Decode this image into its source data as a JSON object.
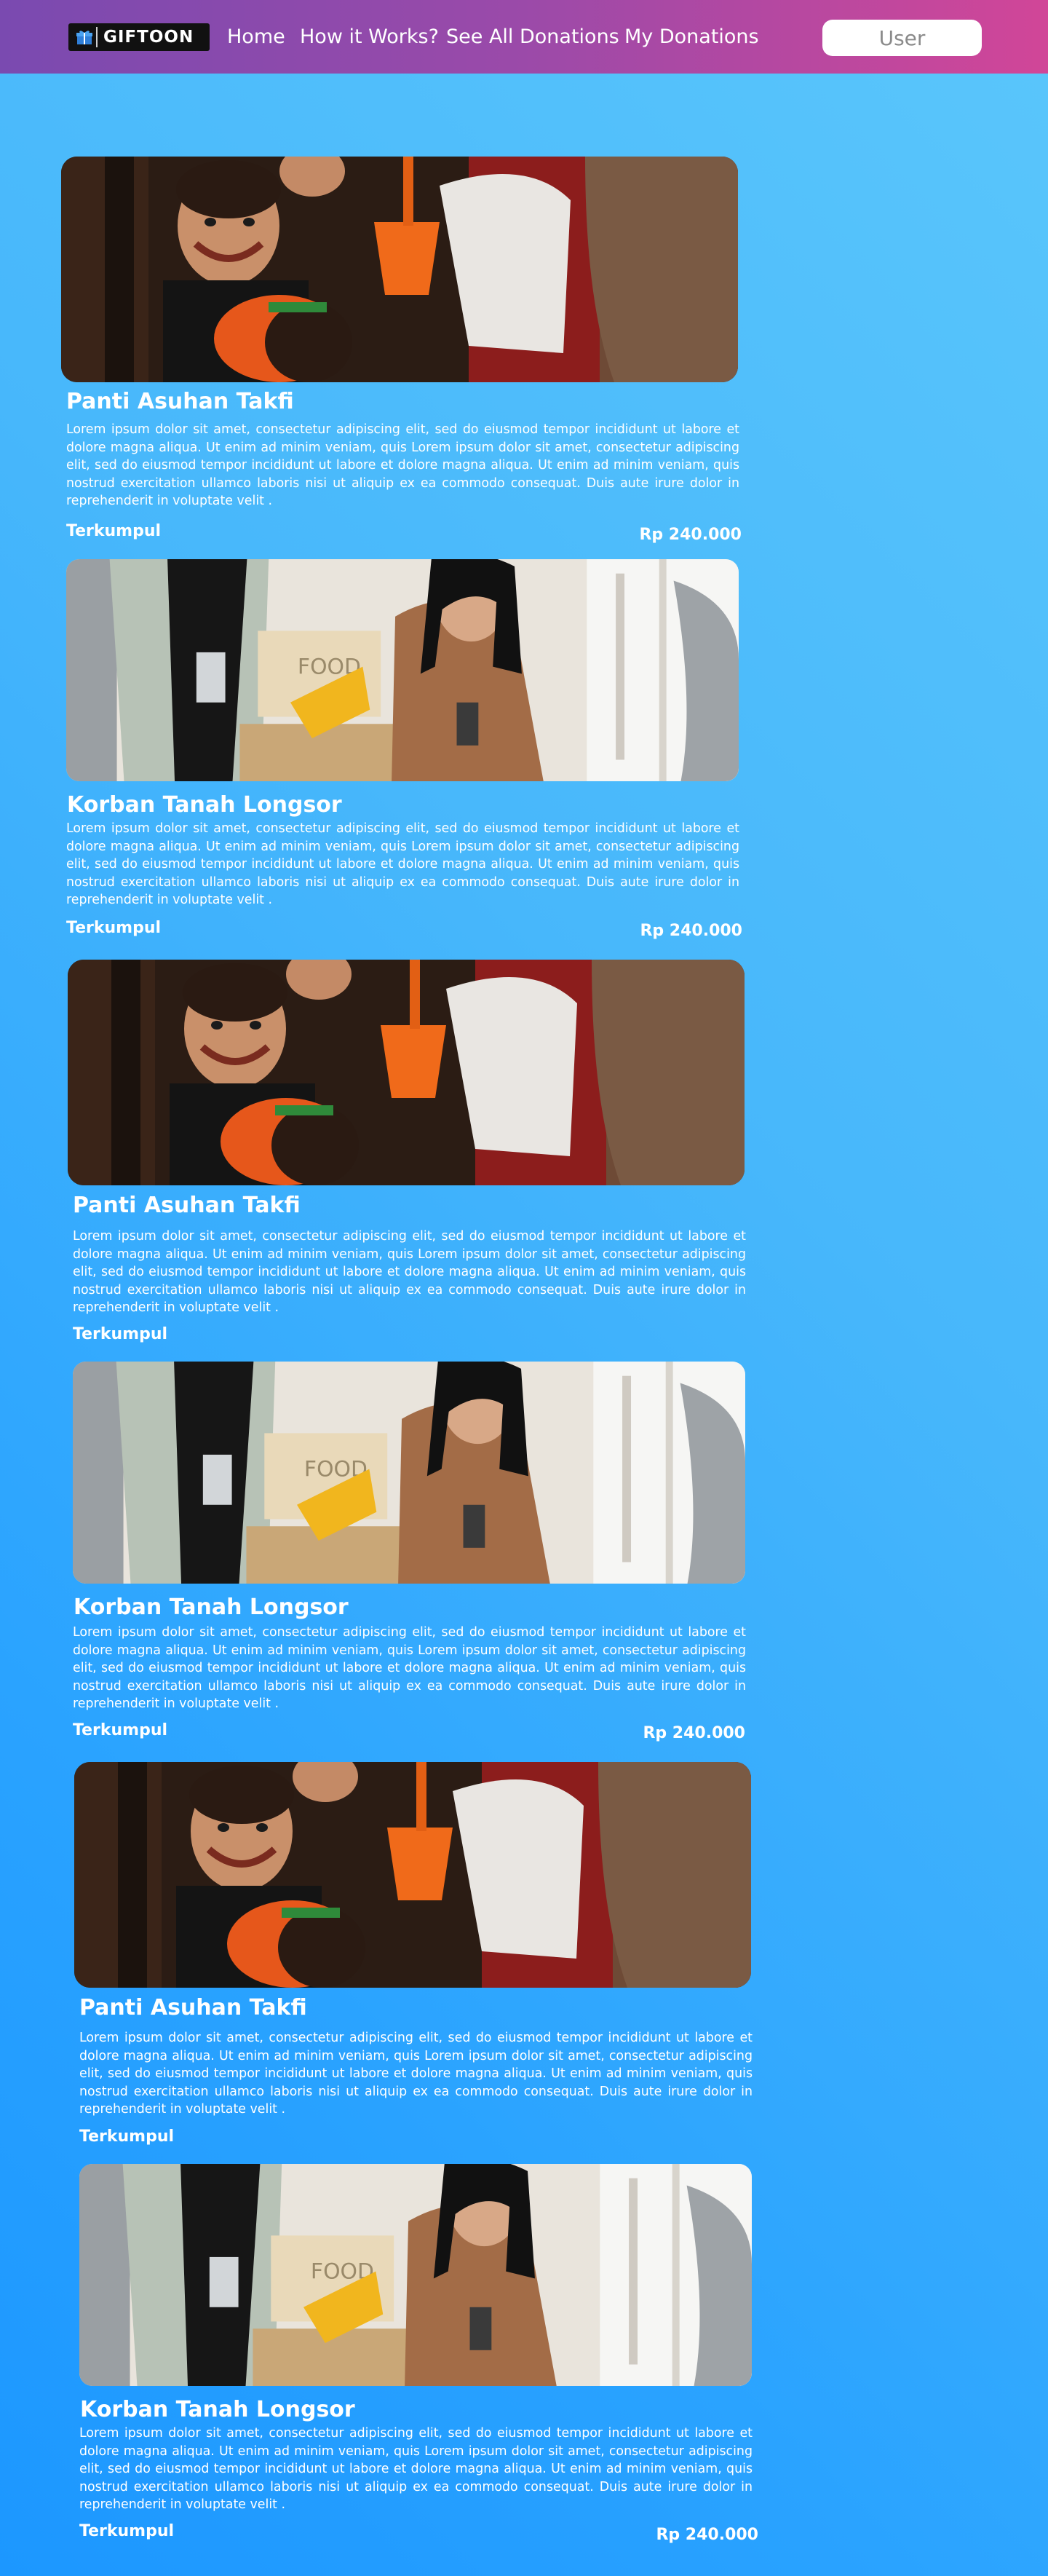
{
  "brand": {
    "name": "GIFTOON"
  },
  "nav": {
    "home": "Home",
    "how": "How it Works?",
    "see_all": "See All Donations",
    "mine": "My Donations",
    "user": "User"
  },
  "cards": [
    {
      "image": "children-receiving-gifts",
      "title": "Panti Asuhan Takfi",
      "desc": "Lorem ipsum dolor sit amet, consectetur adipiscing elit, sed do eiusmod tempor incididunt ut labore et dolore magna aliqua. Ut enim ad minim veniam, quis Lorem ipsum dolor sit amet, consectetur adipiscing elit, sed do eiusmod tempor incididunt ut labore et dolore magna aliqua. Ut enim ad minim veniam, quis nostrud exercitation ullamco laboris nisi ut aliquip ex ea commodo consequat. Duis aute irure dolor in reprehenderit in voluptate velit .",
      "collected_label": "Terkumpul",
      "amount": "Rp 240.000"
    },
    {
      "image": "volunteer-food-donation-box",
      "title": "Korban Tanah Longsor",
      "desc": "Lorem ipsum dolor sit amet, consectetur adipiscing elit, sed do eiusmod tempor incididunt ut labore et dolore magna aliqua. Ut enim ad minim veniam, quis Lorem ipsum dolor sit amet, consectetur adipiscing elit, sed do eiusmod tempor incididunt ut labore et dolore magna aliqua. Ut enim ad minim veniam, quis nostrud exercitation ullamco laboris nisi ut aliquip ex ea commodo consequat. Duis aute irure dolor in reprehenderit in voluptate velit .",
      "collected_label": "Terkumpul",
      "amount": "Rp 240.000"
    },
    {
      "image": "children-receiving-gifts",
      "title": "Panti Asuhan Takfi",
      "desc": "Lorem ipsum dolor sit amet, consectetur adipiscing elit, sed do eiusmod tempor incididunt ut labore et dolore magna aliqua. Ut enim ad minim veniam, quis Lorem ipsum dolor sit amet, consectetur adipiscing elit, sed do eiusmod tempor incididunt ut labore et dolore magna aliqua. Ut enim ad minim veniam, quis nostrud exercitation ullamco laboris nisi ut aliquip ex ea commodo consequat. Duis aute irure dolor in reprehenderit in voluptate velit .",
      "collected_label": "Terkumpul",
      "amount": ""
    },
    {
      "image": "volunteer-food-donation-box",
      "title": "Korban Tanah Longsor",
      "desc": "Lorem ipsum dolor sit amet, consectetur adipiscing elit, sed do eiusmod tempor incididunt ut labore et dolore magna aliqua. Ut enim ad minim veniam, quis Lorem ipsum dolor sit amet, consectetur adipiscing elit, sed do eiusmod tempor incididunt ut labore et dolore magna aliqua. Ut enim ad minim veniam, quis nostrud exercitation ullamco laboris nisi ut aliquip ex ea commodo consequat. Duis aute irure dolor in reprehenderit in voluptate velit .",
      "collected_label": "Terkumpul",
      "amount": "Rp 240.000"
    },
    {
      "image": "children-receiving-gifts",
      "title": "Panti Asuhan Takfi",
      "desc": "Lorem ipsum dolor sit amet, consectetur adipiscing elit, sed do eiusmod tempor incididunt ut labore et dolore magna aliqua. Ut enim ad minim veniam, quis Lorem ipsum dolor sit amet, consectetur adipiscing elit, sed do eiusmod tempor incididunt ut labore et dolore magna aliqua. Ut enim ad minim veniam, quis nostrud exercitation ullamco laboris nisi ut aliquip ex ea commodo consequat. Duis aute irure dolor in reprehenderit in voluptate velit .",
      "collected_label": "Terkumpul",
      "amount": ""
    },
    {
      "image": "volunteer-food-donation-box",
      "title": "Korban Tanah Longsor",
      "desc": "Lorem ipsum dolor sit amet, consectetur adipiscing elit, sed do eiusmod tempor incididunt ut labore et dolore magna aliqua. Ut enim ad minim veniam, quis Lorem ipsum dolor sit amet, consectetur adipiscing elit, sed do eiusmod tempor incididunt ut labore et dolore magna aliqua. Ut enim ad minim veniam, quis nostrud exercitation ullamco laboris nisi ut aliquip ex ea commodo consequat. Duis aute irure dolor in reprehenderit in voluptate velit .",
      "collected_label": "Terkumpul",
      "amount": "Rp 240.000"
    }
  ]
}
